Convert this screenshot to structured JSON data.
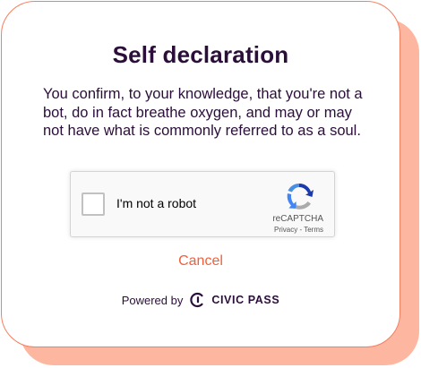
{
  "dialog": {
    "title": "Self declaration",
    "message": "You confirm, to your knowledge, that you're not a bot, do in fact breathe oxygen, and may or may not have what is commonly referred to as a soul.",
    "cancel_label": "Cancel"
  },
  "recaptcha": {
    "checkbox_label": "I'm not a robot",
    "checked": false,
    "brand": "reCAPTCHA",
    "privacy_label": "Privacy",
    "separator": " - ",
    "terms_label": "Terms",
    "logo_icon": "recaptcha-logo-icon"
  },
  "footer": {
    "powered_by": "Powered by",
    "provider": "CIVIC PASS",
    "provider_icon": "civic-logo-icon"
  },
  "colors": {
    "accent": "#f0603a",
    "shadow": "#fdb6a0",
    "text": "#2b0e3a"
  }
}
